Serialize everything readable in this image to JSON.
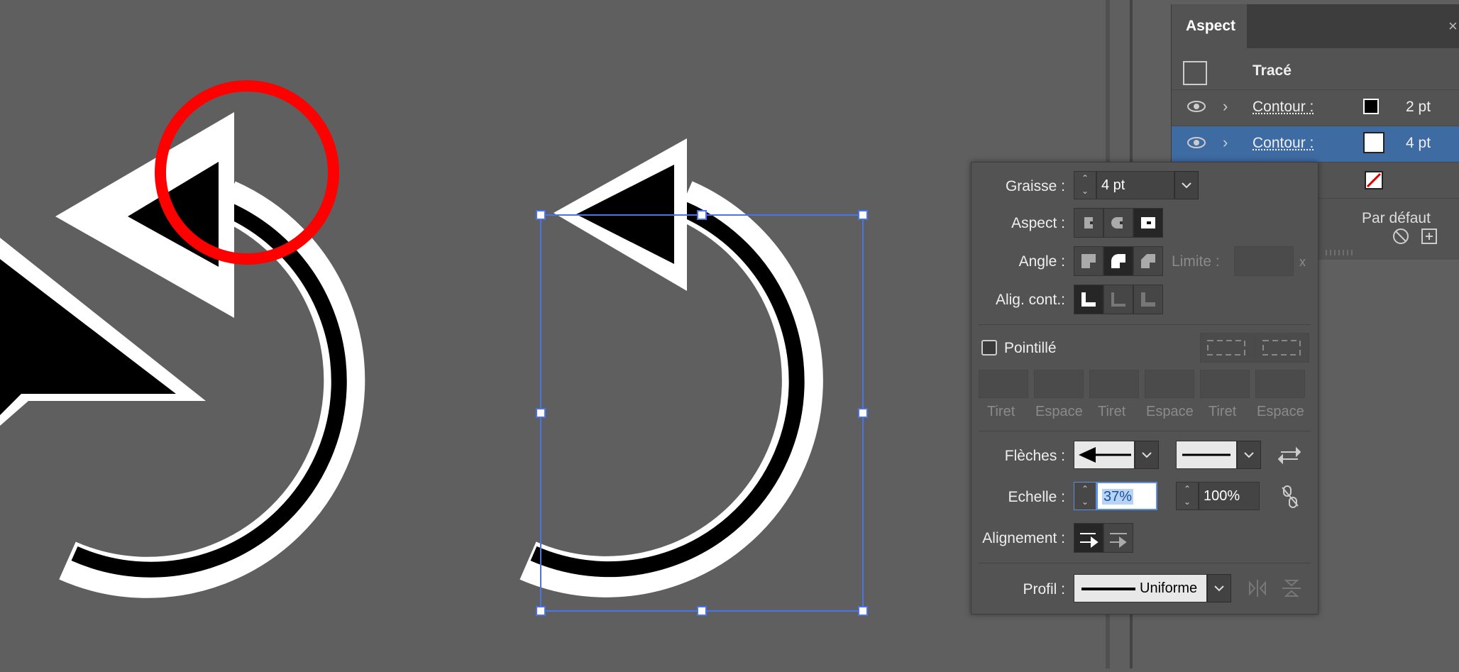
{
  "aspect_panel": {
    "tab": "Aspect",
    "close": "×",
    "header": "Tracé",
    "rows": [
      {
        "label": "Contour :",
        "weight": "2 pt",
        "swatch": "#000000"
      },
      {
        "label": "Contour :",
        "weight": "4 pt",
        "swatch": "#ffffff"
      }
    ],
    "default_label": "Par défaut"
  },
  "stroke_panel": {
    "weight_label": "Graisse :",
    "weight_value": "4 pt",
    "cap_label": "Aspect :",
    "join_label": "Angle :",
    "limit_label": "Limite :",
    "limit_x": "x",
    "align_label": "Alig. cont.:",
    "dashed_label": "Pointillé",
    "dash_labels": [
      "Tiret",
      "Espace",
      "Tiret",
      "Espace",
      "Tiret",
      "Espace"
    ],
    "arrows_label": "Flèches :",
    "scale_label": "Echelle :",
    "scale_start": "37%",
    "scale_end": "100%",
    "alignment_label": "Alignement :",
    "profile_label": "Profil :",
    "profile_value": "Uniforme"
  },
  "colors": {
    "canvas": "#5f5f5f",
    "selection": "#3f6ba3",
    "highlight_circle": "#ff0000",
    "selection_box": "#4a73e8"
  }
}
